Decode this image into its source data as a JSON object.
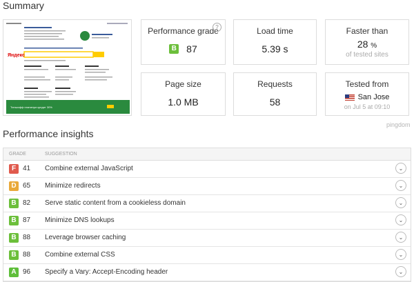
{
  "summary_title": "Summary",
  "thumbnail": {
    "brand": "Яндекс",
    "bottom_banner": "Тинькофф платинум кредит 30%",
    "colors": {
      "accent": "#ffcc00",
      "banner": "#2a8a3e"
    }
  },
  "cards": {
    "grade": {
      "label": "Performance grade",
      "letter": "B",
      "value": "87",
      "help": "?"
    },
    "load_time": {
      "label": "Load time",
      "value": "5.39 s"
    },
    "faster": {
      "label": "Faster than",
      "value": "28",
      "unit": "%",
      "sub": "of tested sites"
    },
    "page_size": {
      "label": "Page size",
      "value": "1.0 MB"
    },
    "requests": {
      "label": "Requests",
      "value": "58"
    },
    "tested_from": {
      "label": "Tested from",
      "location": "San Jose",
      "date": "on Jul 5 at 09:10"
    }
  },
  "pingdom": "pingdom",
  "insights": {
    "title": "Performance insights",
    "headers": {
      "grade": "GRADE",
      "suggestion": "SUGGESTION"
    },
    "rows": [
      {
        "letter": "F",
        "score": "41",
        "text": "Combine external JavaScript"
      },
      {
        "letter": "D",
        "score": "65",
        "text": "Minimize redirects"
      },
      {
        "letter": "B",
        "score": "82",
        "text": "Serve static content from a cookieless domain"
      },
      {
        "letter": "B",
        "score": "87",
        "text": "Minimize DNS lookups"
      },
      {
        "letter": "B",
        "score": "88",
        "text": "Leverage browser caching"
      },
      {
        "letter": "B",
        "score": "88",
        "text": "Combine external CSS"
      },
      {
        "letter": "A",
        "score": "96",
        "text": "Specify a Vary: Accept-Encoding header"
      }
    ]
  },
  "colors": {
    "grade_F": "#e05a4d",
    "grade_D": "#e9a93a",
    "grade_B": "#6cbf3b",
    "grade_A": "#5ebe3a"
  }
}
